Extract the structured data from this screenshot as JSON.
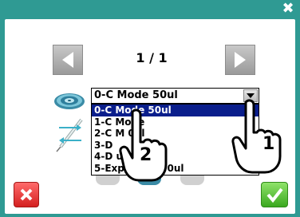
{
  "window": {
    "close_glyph": "✖"
  },
  "pager": {
    "indicator": "1 / 1",
    "prev_icon": "triangle-left-icon",
    "next_icon": "triangle-right-icon"
  },
  "mode_select": {
    "current_value": "0-C Mode 50ul",
    "options": [
      {
        "label": "0-C Mode 50ul",
        "selected": true
      },
      {
        "label": "1-C Mode",
        "selected": false
      },
      {
        "label": "2-C M    0ul",
        "selected": false
      },
      {
        "label": "3-D",
        "selected": false
      },
      {
        "label": "4-D    ul",
        "selected": false
      },
      {
        "label": "5-Exp     Mode 50ul",
        "selected": false
      }
    ]
  },
  "annotations": {
    "step_1": "1",
    "step_2": "2"
  },
  "footer": {
    "cancel_icon": "x-icon",
    "confirm_icon": "check-icon"
  },
  "colors": {
    "frame": "#2f9a93",
    "selected_option": "#0a1e8c",
    "cancel": "#d42020",
    "confirm": "#3aa81f"
  }
}
